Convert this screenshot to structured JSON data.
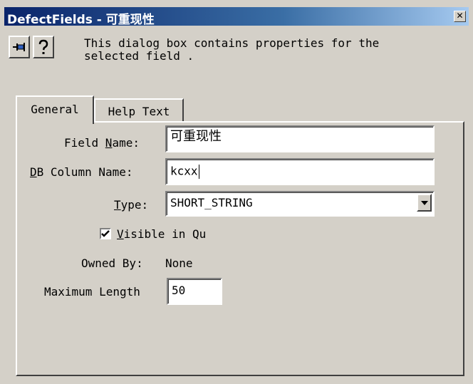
{
  "window": {
    "title": "DefectFields - 可重现性",
    "close_glyph": "✕"
  },
  "toolbar": {
    "pin_icon": "pushpin-icon",
    "help_icon": "question-icon",
    "description": "This dialog box contains properties for the\nselected field ."
  },
  "tabs": [
    {
      "label": "General",
      "active": true
    },
    {
      "label": "Help Text",
      "active": false
    }
  ],
  "form": {
    "field_name": {
      "label_prefix": "Field ",
      "label_mnemonic": "N",
      "label_suffix": "ame:",
      "value": "可重现性"
    },
    "db_column": {
      "label_mnemonic": "D",
      "label_suffix": "B Column Name:",
      "value": "kcxx"
    },
    "type": {
      "label_mnemonic": "T",
      "label_suffix": "ype:",
      "value": "SHORT_STRING"
    },
    "visible": {
      "label_mnemonic": "V",
      "label_suffix": "isible in Qu",
      "checked": true
    },
    "owned_by": {
      "label": "Owned By:",
      "value": "None"
    },
    "max_length": {
      "label": "Maximum Length",
      "value": "50"
    }
  },
  "colors": {
    "title_start": "#0a246a",
    "title_end": "#a6caf0",
    "face": "#d4d0c8"
  }
}
